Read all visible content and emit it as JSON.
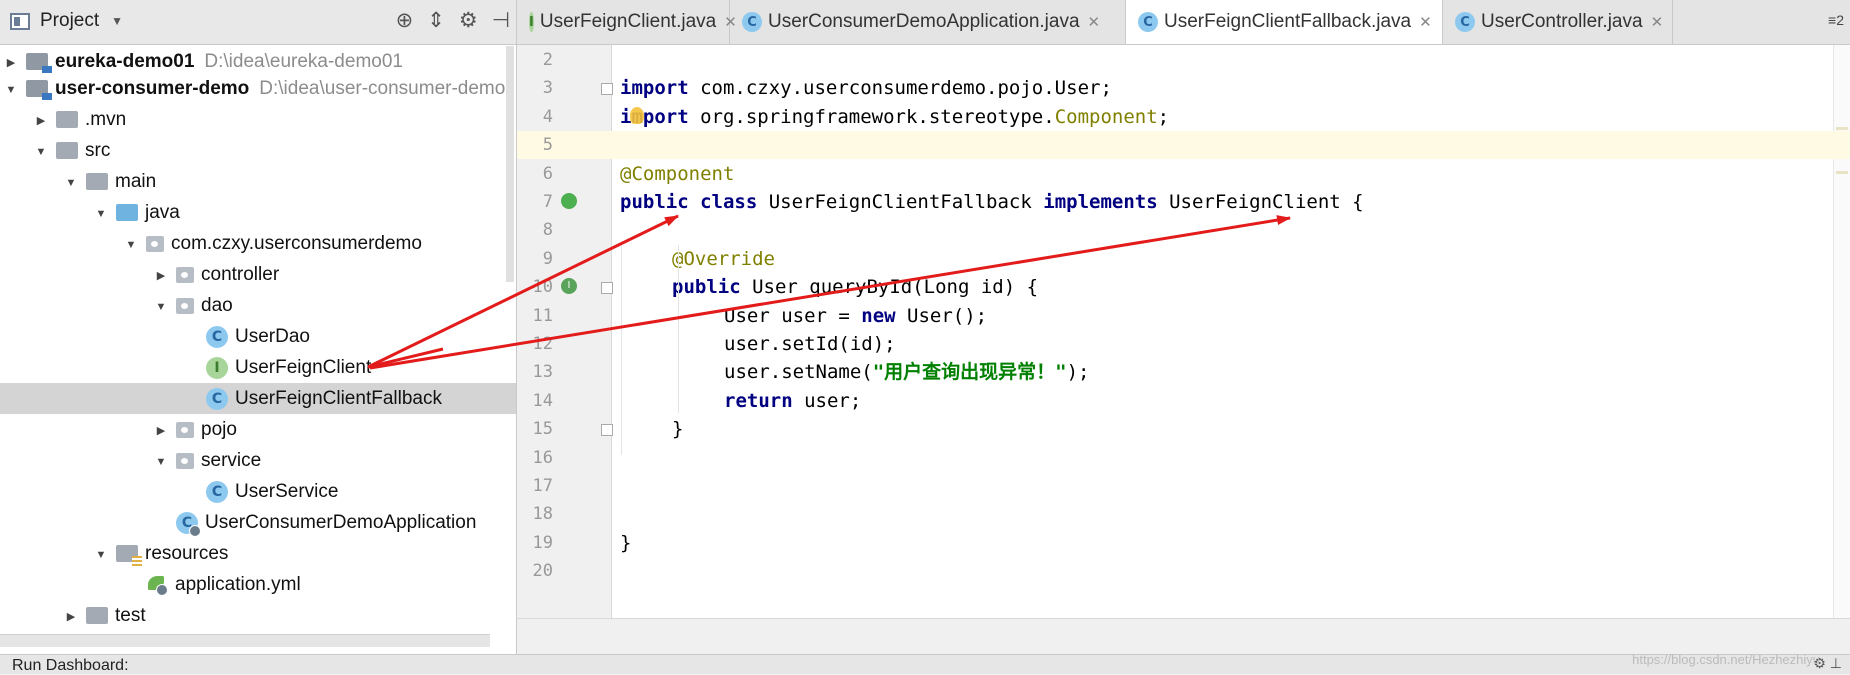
{
  "project_panel": {
    "title": "Project",
    "tree": [
      {
        "label": "eureka-demo01",
        "path": "D:\\idea\\eureka-demo01",
        "bold": true
      },
      {
        "label": "user-consumer-demo",
        "path": "D:\\idea\\user-consumer-demo",
        "bold": true
      },
      {
        "label": ".mvn"
      },
      {
        "label": "src"
      },
      {
        "label": "main"
      },
      {
        "label": "java"
      },
      {
        "label": "com.czxy.userconsumerdemo"
      },
      {
        "label": "controller"
      },
      {
        "label": "dao"
      },
      {
        "label": "UserDao"
      },
      {
        "label": "UserFeignClient"
      },
      {
        "label": "UserFeignClientFallback"
      },
      {
        "label": "pojo"
      },
      {
        "label": "service"
      },
      {
        "label": "UserService"
      },
      {
        "label": "UserConsumerDemoApplication"
      },
      {
        "label": "resources"
      },
      {
        "label": "application.yml"
      },
      {
        "label": "test"
      }
    ]
  },
  "tabs": [
    {
      "label": "UserFeignClient.java",
      "icon": "I"
    },
    {
      "label": "UserConsumerDemoApplication.java",
      "icon": "C"
    },
    {
      "label": "UserFeignClientFallback.java",
      "icon": "C"
    },
    {
      "label": "UserController.java",
      "icon": "C"
    }
  ],
  "tab_more": "≡2",
  "editor": {
    "lines": [
      {
        "n": "2"
      },
      {
        "n": "3",
        "parts": [
          [
            "kw",
            "import"
          ],
          [
            "",
            "com.czxy.userconsumerdemo.pojo.User;"
          ]
        ]
      },
      {
        "n": "4",
        "parts": [
          [
            "kw",
            "import"
          ],
          [
            "",
            "org.springframework.stereotype."
          ],
          [
            "cls-ref",
            "Component"
          ],
          [
            "",
            ";"
          ]
        ]
      },
      {
        "n": "5"
      },
      {
        "n": "6",
        "parts": [
          [
            "ann",
            "@Component"
          ]
        ]
      },
      {
        "n": "7",
        "parts": [
          [
            "kw",
            "public"
          ],
          [
            "kw",
            "class"
          ],
          [
            "",
            "UserFeignClientFallback"
          ],
          [
            "kw",
            "implements"
          ],
          [
            "",
            "UserFeignClient {"
          ]
        ]
      },
      {
        "n": "8"
      },
      {
        "n": "9",
        "parts": [
          [
            "ann",
            "@Override"
          ]
        ]
      },
      {
        "n": "10",
        "parts": [
          [
            "kw",
            "public"
          ],
          [
            "",
            "User queryById(Long id) {"
          ]
        ]
      },
      {
        "n": "11",
        "parts": [
          [
            "",
            "User user = "
          ],
          [
            "kw",
            "new"
          ],
          [
            "",
            "User();"
          ]
        ]
      },
      {
        "n": "12",
        "parts": [
          [
            "",
            "user.setId(id);"
          ]
        ]
      },
      {
        "n": "13",
        "parts": [
          [
            "",
            "user.setName("
          ],
          [
            "str",
            "\"用户查询出现异常！\""
          ],
          [
            "",
            ");"
          ]
        ]
      },
      {
        "n": "14",
        "parts": [
          [
            "kw",
            "return"
          ],
          [
            "",
            "user;"
          ]
        ]
      },
      {
        "n": "15",
        "parts": [
          [
            "",
            "}"
          ]
        ]
      },
      {
        "n": "16"
      },
      {
        "n": "17"
      },
      {
        "n": "18"
      },
      {
        "n": "19",
        "parts": [
          [
            "",
            "}"
          ]
        ]
      },
      {
        "n": "20"
      }
    ]
  },
  "status_bar": {
    "run_dashboard": "Run Dashboard:",
    "watermark": "https://blog.csdn.net/Hezhezhiyu"
  },
  "colors": {
    "annotation_arrow": "#e31b1b",
    "selected_row": "#d4d4d4",
    "current_line": "#fffae3"
  }
}
